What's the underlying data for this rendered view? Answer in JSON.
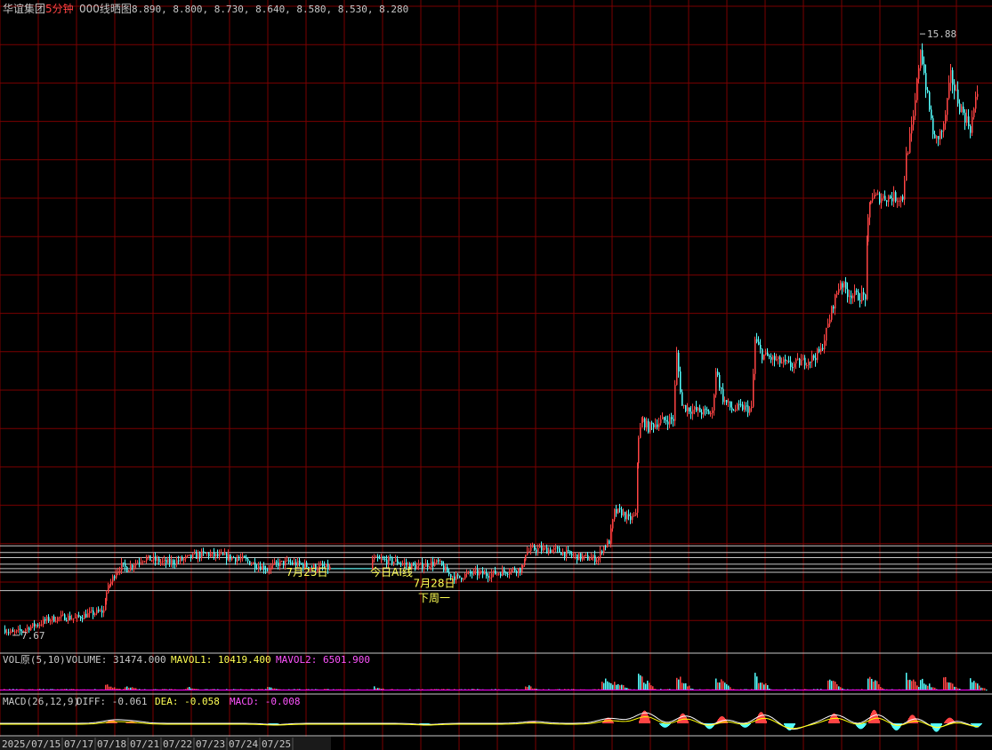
{
  "header": {
    "stock_name": "华谊集团",
    "period": "5分钟",
    "indicator": "000线晒图",
    "levels_text": "8.890, 8.800, 8.730, 8.640, 8.580, 8.530, 8.280"
  },
  "vol_header": {
    "label": "VOL原(5,10)",
    "volume": "VOLUME: 31474.000",
    "mavol1": "MAVOL1: 10419.400",
    "mavol2": "MAVOL2: 6501.900"
  },
  "macd_header": {
    "label": "MACD(26,12,9)",
    "diff": "DIFF: -0.061",
    "dea": "DEA: -0.058",
    "macd": "MACD: -0.008"
  },
  "colors": {
    "up": "#ff4444",
    "down": "#54ffff",
    "grid": "#7a0000",
    "level": "#c8c8c8",
    "axis_text": "#c8c8c8",
    "annot": "#ffff54",
    "mavol1": "#ffff00",
    "mavol2": "#ff00ff",
    "diff": "#ffffff",
    "dea": "#ffff00"
  },
  "chart_data": {
    "type": "candlestick",
    "title": "华谊集团5分钟 000线晒图",
    "x_ticks": [
      "2025/07/15",
      "07/17",
      "07/18",
      "07/21",
      "07/22",
      "07/23",
      "07/24",
      "07/25"
    ],
    "ylim": [
      7.45,
      16.1
    ],
    "levels": [
      8.89,
      8.8,
      8.73,
      8.64,
      8.58,
      8.53,
      8.28
    ],
    "annotations": [
      {
        "text": "7月25日",
        "x": 345,
        "y": 8.6
      },
      {
        "text": "今日AI线",
        "x": 440,
        "y": 8.6
      },
      {
        "text": "7月28日",
        "x": 488,
        "y": 8.45
      },
      {
        "text": "下周一",
        "x": 488,
        "y": 8.25
      }
    ],
    "low_label": {
      "text": "7.67",
      "value": 7.67
    },
    "high_label": {
      "text": "15.88",
      "value": 15.88
    },
    "price_path": [
      [
        5,
        7.75
      ],
      [
        14,
        7.7
      ],
      [
        24,
        7.73
      ],
      [
        32,
        7.78
      ],
      [
        42,
        7.82
      ],
      [
        52,
        7.88
      ],
      [
        62,
        7.9
      ],
      [
        72,
        7.92
      ],
      [
        84,
        7.9
      ],
      [
        96,
        7.95
      ],
      [
        108,
        7.98
      ],
      [
        116,
        8.0
      ],
      [
        119,
        8.25
      ],
      [
        124,
        8.4
      ],
      [
        130,
        8.55
      ],
      [
        136,
        8.62
      ],
      [
        142,
        8.58
      ],
      [
        150,
        8.65
      ],
      [
        160,
        8.72
      ],
      [
        172,
        8.7
      ],
      [
        184,
        8.66
      ],
      [
        198,
        8.68
      ],
      [
        210,
        8.72
      ],
      [
        222,
        8.76
      ],
      [
        232,
        8.78
      ],
      [
        242,
        8.75
      ],
      [
        254,
        8.74
      ],
      [
        266,
        8.72
      ],
      [
        278,
        8.68
      ],
      [
        290,
        8.62
      ],
      [
        300,
        8.58
      ],
      [
        312,
        8.65
      ],
      [
        324,
        8.66
      ],
      [
        336,
        8.64
      ],
      [
        350,
        8.6
      ],
      [
        362,
        8.6
      ],
      [
        372,
        8.58
      ],
      [
        418,
        8.7
      ],
      [
        432,
        8.69
      ],
      [
        444,
        8.68
      ],
      [
        456,
        8.64
      ],
      [
        468,
        8.6
      ],
      [
        480,
        8.64
      ],
      [
        492,
        8.66
      ],
      [
        504,
        8.5
      ],
      [
        514,
        8.45
      ],
      [
        522,
        8.49
      ],
      [
        532,
        8.52
      ],
      [
        546,
        8.5
      ],
      [
        558,
        8.52
      ],
      [
        570,
        8.55
      ],
      [
        580,
        8.57
      ],
      [
        587,
        8.58
      ],
      [
        590,
        8.8
      ],
      [
        600,
        8.85
      ],
      [
        612,
        8.84
      ],
      [
        624,
        8.83
      ],
      [
        632,
        8.8
      ],
      [
        642,
        8.76
      ],
      [
        654,
        8.73
      ],
      [
        664,
        8.72
      ],
      [
        672,
        8.72
      ],
      [
        676,
        8.85
      ],
      [
        684,
        8.95
      ],
      [
        690,
        9.35
      ],
      [
        698,
        9.35
      ],
      [
        706,
        9.25
      ],
      [
        714,
        9.3
      ],
      [
        717,
        10.4
      ],
      [
        722,
        10.6
      ],
      [
        728,
        10.5
      ],
      [
        734,
        10.55
      ],
      [
        744,
        10.6
      ],
      [
        756,
        10.62
      ],
      [
        760,
        11.5
      ],
      [
        766,
        10.8
      ],
      [
        776,
        10.75
      ],
      [
        788,
        10.72
      ],
      [
        800,
        10.7
      ],
      [
        804,
        11.3
      ],
      [
        812,
        10.9
      ],
      [
        822,
        10.75
      ],
      [
        834,
        10.78
      ],
      [
        844,
        10.75
      ],
      [
        848,
        11.7
      ],
      [
        856,
        11.5
      ],
      [
        866,
        11.45
      ],
      [
        876,
        11.4
      ],
      [
        888,
        11.35
      ],
      [
        900,
        11.4
      ],
      [
        912,
        11.45
      ],
      [
        922,
        11.55
      ],
      [
        930,
        11.9
      ],
      [
        936,
        12.2
      ],
      [
        944,
        12.5
      ],
      [
        952,
        12.35
      ],
      [
        962,
        12.3
      ],
      [
        972,
        12.3
      ],
      [
        975,
        13.3
      ],
      [
        978,
        13.65
      ],
      [
        990,
        13.65
      ],
      [
        1000,
        13.65
      ],
      [
        1014,
        13.65
      ],
      [
        1018,
        14.2
      ],
      [
        1026,
        14.7
      ],
      [
        1034,
        15.7
      ],
      [
        1042,
        15.0
      ],
      [
        1050,
        14.4
      ],
      [
        1060,
        14.6
      ],
      [
        1068,
        15.3
      ],
      [
        1078,
        14.9
      ],
      [
        1090,
        14.6
      ],
      [
        1100,
        15.2
      ]
    ],
    "volume_spikes": [
      [
        118,
        0.4
      ],
      [
        140,
        0.3
      ],
      [
        210,
        0.2
      ],
      [
        300,
        0.2
      ],
      [
        420,
        0.2
      ],
      [
        590,
        0.3
      ],
      [
        676,
        0.7
      ],
      [
        690,
        0.5
      ],
      [
        717,
        1.0
      ],
      [
        760,
        0.9
      ],
      [
        804,
        0.8
      ],
      [
        848,
        0.85
      ],
      [
        930,
        0.7
      ],
      [
        975,
        1.0
      ],
      [
        1018,
        0.9
      ],
      [
        1034,
        0.7
      ],
      [
        1060,
        0.8
      ],
      [
        1090,
        0.6
      ]
    ],
    "macd_bars": [
      [
        118,
        0.25
      ],
      [
        140,
        0.15
      ],
      [
        300,
        -0.1
      ],
      [
        470,
        -0.1
      ],
      [
        590,
        0.15
      ],
      [
        676,
        0.4
      ],
      [
        717,
        0.9
      ],
      [
        740,
        -0.3
      ],
      [
        760,
        0.7
      ],
      [
        790,
        -0.4
      ],
      [
        804,
        0.5
      ],
      [
        830,
        -0.3
      ],
      [
        848,
        0.8
      ],
      [
        880,
        -0.5
      ],
      [
        930,
        0.7
      ],
      [
        960,
        -0.4
      ],
      [
        975,
        0.95
      ],
      [
        1000,
        -0.5
      ],
      [
        1018,
        0.6
      ],
      [
        1045,
        -0.6
      ],
      [
        1060,
        0.4
      ],
      [
        1090,
        -0.3
      ]
    ]
  }
}
